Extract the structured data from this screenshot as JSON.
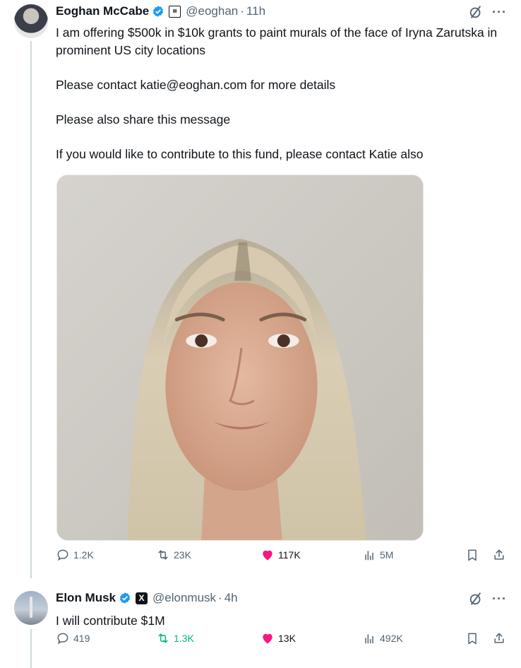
{
  "colors": {
    "verified": "#1d9bf0",
    "like": "#f91880",
    "repost_active": "#00ba7c",
    "muted": "#536471"
  },
  "tweets": [
    {
      "name": "Eoghan McCabe",
      "handle": "@eoghan",
      "separator": "·",
      "time": "11h",
      "affiliate_icon": "intercom-badge-icon",
      "body": [
        "I am offering $500k in $10k grants to paint murals of the face of Iryna Zarutska in prominent US city locations",
        "Please contact katie@eoghan.com for more details",
        "Please also share this message",
        "If you would like to contribute to this fund, please contact Katie also"
      ],
      "media": "photo",
      "stats": {
        "replies": "1.2K",
        "reposts": "23K",
        "likes": "117K",
        "views": "5M"
      }
    },
    {
      "name": "Elon Musk",
      "handle": "@elonmusk",
      "separator": "·",
      "time": "4h",
      "affiliate_icon": "x-badge-icon",
      "body": [
        "I will contribute $1M"
      ],
      "stats": {
        "replies": "419",
        "reposts": "1.3K",
        "likes": "13K",
        "views": "492K"
      }
    }
  ]
}
